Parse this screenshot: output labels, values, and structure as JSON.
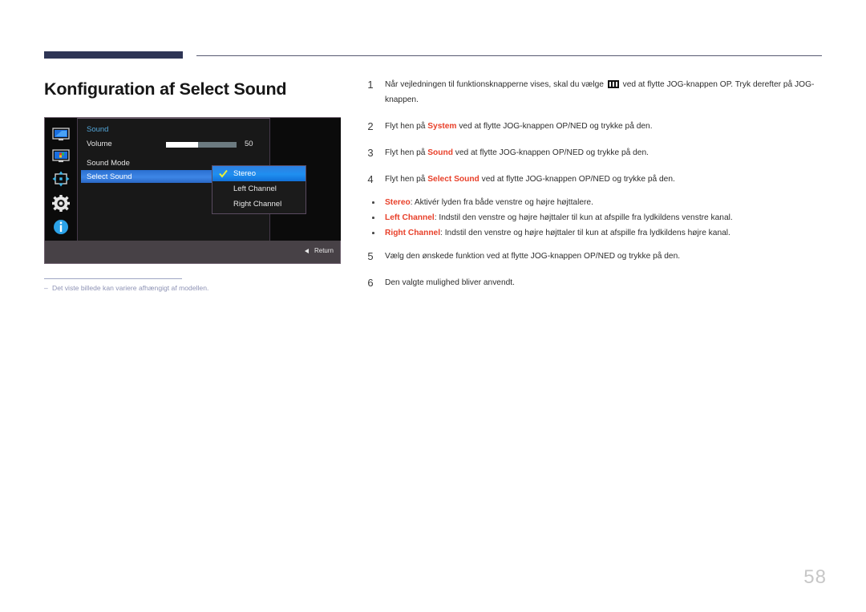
{
  "page_title": "Konfiguration af Select Sound",
  "page_number": "58",
  "osd": {
    "heading": "Sound",
    "sidebar_icons": [
      {
        "name": "monitor-picture-icon"
      },
      {
        "name": "picture-in-picture-icon"
      },
      {
        "name": "screen-adjust-icon"
      },
      {
        "name": "system-gear-icon"
      },
      {
        "name": "information-icon"
      }
    ],
    "rows": [
      {
        "label": "Volume",
        "value": "50",
        "slider_percent": 46
      },
      {
        "label": "Sound Mode",
        "value": ""
      },
      {
        "label": "Select Sound",
        "value": "",
        "highlighted": true
      }
    ],
    "dropdown": {
      "items": [
        {
          "label": "Stereo",
          "selected": true
        },
        {
          "label": "Left Channel",
          "selected": false
        },
        {
          "label": "Right Channel",
          "selected": false
        }
      ]
    },
    "footer": {
      "return_label": "Return"
    }
  },
  "footnote": {
    "dash": "‒",
    "text": "Det viste billede kan variere afhængigt af modellen."
  },
  "steps": [
    {
      "num": "1",
      "pre": "Når vejledningen til funktionsknapperne vises, skal du vælge ",
      "has_icon": true,
      "icon_name": "jog-menu-icon",
      "post": " ved at flytte JOG-knappen OP. Tryk derefter på JOG-knappen."
    },
    {
      "num": "2",
      "pre": "Flyt hen på ",
      "bold": "System",
      "post": " ved at flytte JOG-knappen OP/NED og trykke på den."
    },
    {
      "num": "3",
      "pre": "Flyt hen på ",
      "bold": "Sound",
      "post": " ved at flytte JOG-knappen OP/NED og trykke på den."
    },
    {
      "num": "4",
      "pre": "Flyt hen på ",
      "bold": "Select Sound",
      "post": " ved at flytte JOG-knappen OP/NED og trykke på den."
    },
    {
      "num": "5",
      "pre": "Vælg den ønskede funktion ved at flytte JOG-knappen OP/NED og trykke på den.",
      "bold": "",
      "post": ""
    },
    {
      "num": "6",
      "pre": "Den valgte mulighed bliver anvendt.",
      "bold": "",
      "post": ""
    }
  ],
  "bullets": [
    {
      "bold": "Stereo",
      "text": ": Aktivér lyden fra både venstre og højre højttalere."
    },
    {
      "bold": "Left Channel",
      "text": ": Indstil den venstre og højre højttaler til kun at afspille fra lydkildens venstre kanal."
    },
    {
      "bold": "Right Channel",
      "text": ": Indstil den venstre og højre højttaler til kun at afspille fra lydkildens højre kanal."
    }
  ],
  "colors": {
    "header_bar": "#2e3555",
    "accent_red": "#e8402a",
    "osd_highlight_blue": "#2f7fe0",
    "osd_heading_blue": "#53a6d8",
    "footnote_gray": "#8e93b5"
  }
}
